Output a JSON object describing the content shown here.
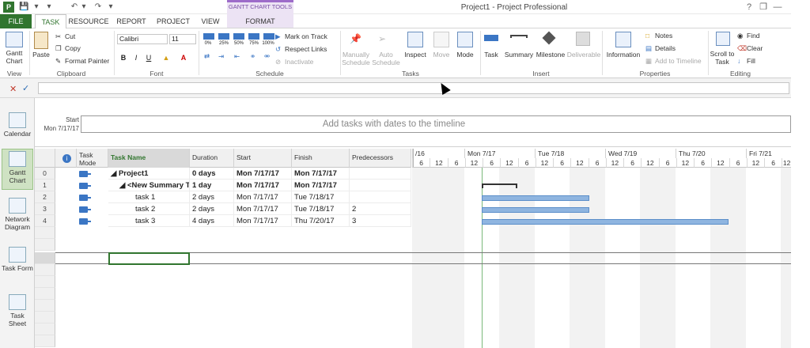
{
  "window": {
    "title": "Project1 - Project Professional",
    "app_badge": "P",
    "qat": [
      "save-icon",
      "undo-icon",
      "redo-icon",
      "dropdown-icon"
    ]
  },
  "tabs": {
    "file": "FILE",
    "task": "TASK",
    "resource": "RESOURCE",
    "report": "REPORT",
    "project": "PROJECT",
    "view": "VIEW",
    "context_group": "GANTT CHART TOOLS",
    "format": "FORMAT"
  },
  "ribbon": {
    "view_group": {
      "label": "View",
      "gantt_chart": "Gantt Chart"
    },
    "clipboard": {
      "label": "Clipboard",
      "paste": "Paste",
      "cut": "Cut",
      "copy": "Copy",
      "format_painter": "Format Painter"
    },
    "font": {
      "label": "Font",
      "family": "Calibri",
      "size": "11",
      "bold": "B",
      "italic": "I",
      "underline": "U"
    },
    "schedule": {
      "label": "Schedule",
      "pct": [
        "0%",
        "25%",
        "50%",
        "75%",
        "100%"
      ],
      "mark_on_track": "Mark on Track",
      "respect_links": "Respect Links",
      "inactivate": "Inactivate"
    },
    "tasks": {
      "label": "Tasks",
      "manually": "Manually Schedule",
      "auto": "Auto Schedule",
      "inspect": "Inspect",
      "move": "Move",
      "mode": "Mode"
    },
    "insert": {
      "label": "Insert",
      "task": "Task",
      "summary": "Summary",
      "milestone": "Milestone",
      "deliverable": "Deliverable"
    },
    "properties": {
      "label": "Properties",
      "information": "Information",
      "notes": "Notes",
      "details": "Details",
      "add_to_timeline": "Add to Timeline"
    },
    "editing": {
      "label": "Editing",
      "scroll_to_task": "Scroll to Task",
      "find": "Find",
      "clear": "Clear",
      "fill": "Fill"
    }
  },
  "viewbar": [
    {
      "label": "Calendar"
    },
    {
      "label": "Gantt Chart"
    },
    {
      "label": "Network Diagram"
    },
    {
      "label": "Task Form"
    },
    {
      "label": "Task Sheet"
    }
  ],
  "timeline": {
    "start_label": "Start",
    "start_date": "Mon 7/17/17",
    "placeholder": "Add tasks with dates to the timeline"
  },
  "grid": {
    "columns": [
      "Task Mode",
      "Task Name",
      "Duration",
      "Start",
      "Finish",
      "Predecessors"
    ],
    "rows": [
      {
        "id": "0",
        "name": "Project1",
        "duration": "0 days",
        "start": "Mon 7/17/17",
        "finish": "Mon 7/17/17",
        "pred": ""
      },
      {
        "id": "1",
        "name": "<New Summary Ta",
        "duration": "1 day",
        "start": "Mon 7/17/17",
        "finish": "Mon 7/17/17",
        "pred": ""
      },
      {
        "id": "2",
        "name": "task 1",
        "duration": "2 days",
        "start": "Mon 7/17/17",
        "finish": "Tue 7/18/17",
        "pred": ""
      },
      {
        "id": "3",
        "name": "task 2",
        "duration": "2 days",
        "start": "Mon 7/17/17",
        "finish": "Tue 7/18/17",
        "pred": "2"
      },
      {
        "id": "4",
        "name": "task 3",
        "duration": "4 days",
        "start": "Mon 7/17/17",
        "finish": "Thu 7/20/17",
        "pred": "3"
      }
    ]
  },
  "gantt": {
    "days": [
      "/16",
      "Mon 7/17",
      "Tue 7/18",
      "Wed 7/19",
      "Thu 7/20",
      "Fri 7/21"
    ],
    "hours": [
      "6",
      "12",
      "6",
      "12",
      "6",
      "12",
      "6",
      "12",
      "6",
      "12",
      "6",
      "12",
      "6",
      "12",
      "6",
      "12",
      "6",
      "12",
      "6",
      "12",
      "6",
      "12"
    ]
  }
}
